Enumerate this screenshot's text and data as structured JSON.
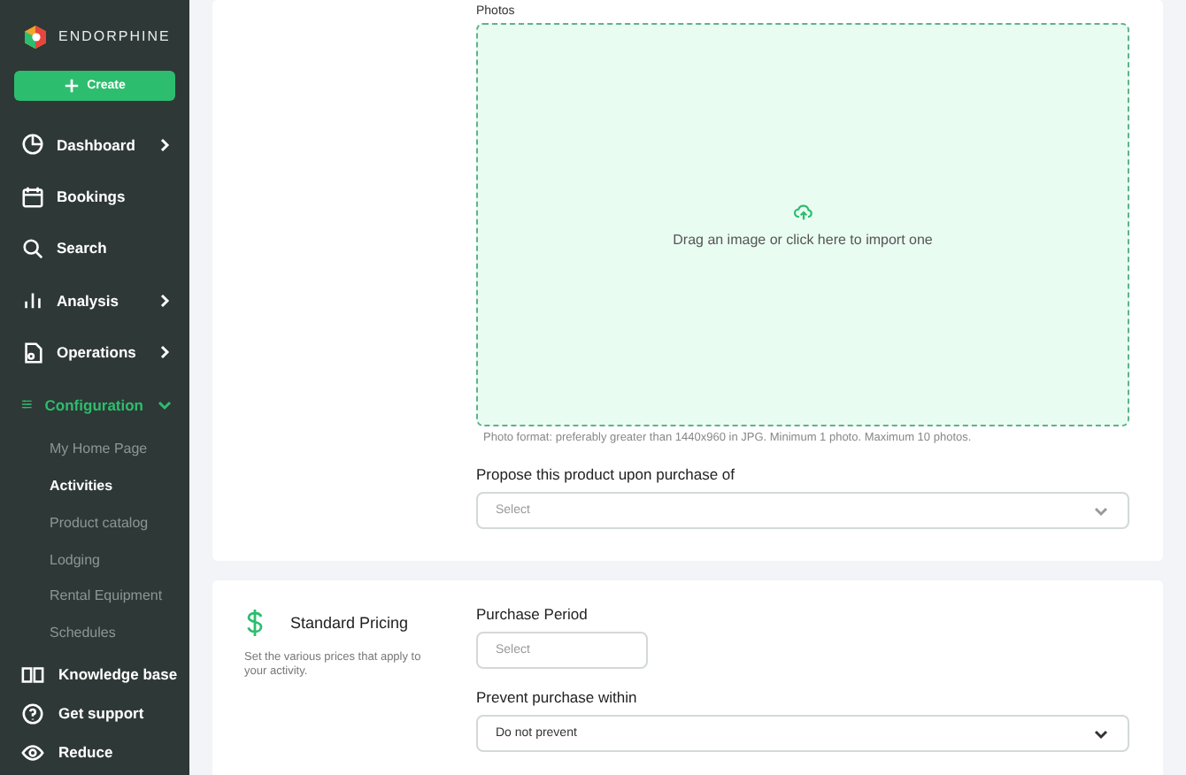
{
  "sidebar": {
    "brand": "ENDORPHINE",
    "create_button": "Create",
    "items": [
      {
        "label": "Dashboard",
        "has_submenu": true,
        "selected": false
      },
      {
        "label": "Bookings",
        "selected": false
      },
      {
        "label": "Search",
        "selected": false
      },
      {
        "label": "Analysis",
        "has_submenu": true,
        "selected": false
      },
      {
        "label": "Operations",
        "has_submenu": true,
        "selected": false
      },
      {
        "label": "Configuration",
        "has_submenu": true,
        "selected": true,
        "children": [
          {
            "label": "My Home Page",
            "selected": false
          },
          {
            "label": "Activities",
            "selected": true
          },
          {
            "label": "Product catalog",
            "selected": false
          },
          {
            "label": "Lodging",
            "selected": false
          },
          {
            "label": "Rental Equipment",
            "selected": false
          },
          {
            "label": "Schedules",
            "selected": false
          }
        ]
      }
    ],
    "footer": [
      {
        "label": "Knowledge base"
      },
      {
        "label": "Get support"
      },
      {
        "label": "Reduce"
      }
    ]
  },
  "photos_section": {
    "photos_label": "Photos",
    "dropzone_text": "Drag an image or click here to import one",
    "hint": "Photo format: preferably greater than 1440x960 in JPG. Minimum 1 photo. Maximum 10 photos.",
    "propose_label": "Propose this product upon purchase of",
    "propose_placeholder": "Select"
  },
  "pricing_section": {
    "title": "Standard Pricing",
    "description": "Set the various prices that apply to your activity.",
    "purchase_period_label": "Purchase Period",
    "purchase_period_placeholder": "Select",
    "prevent_label": "Prevent purchase within",
    "prevent_value": "Do not prevent"
  }
}
